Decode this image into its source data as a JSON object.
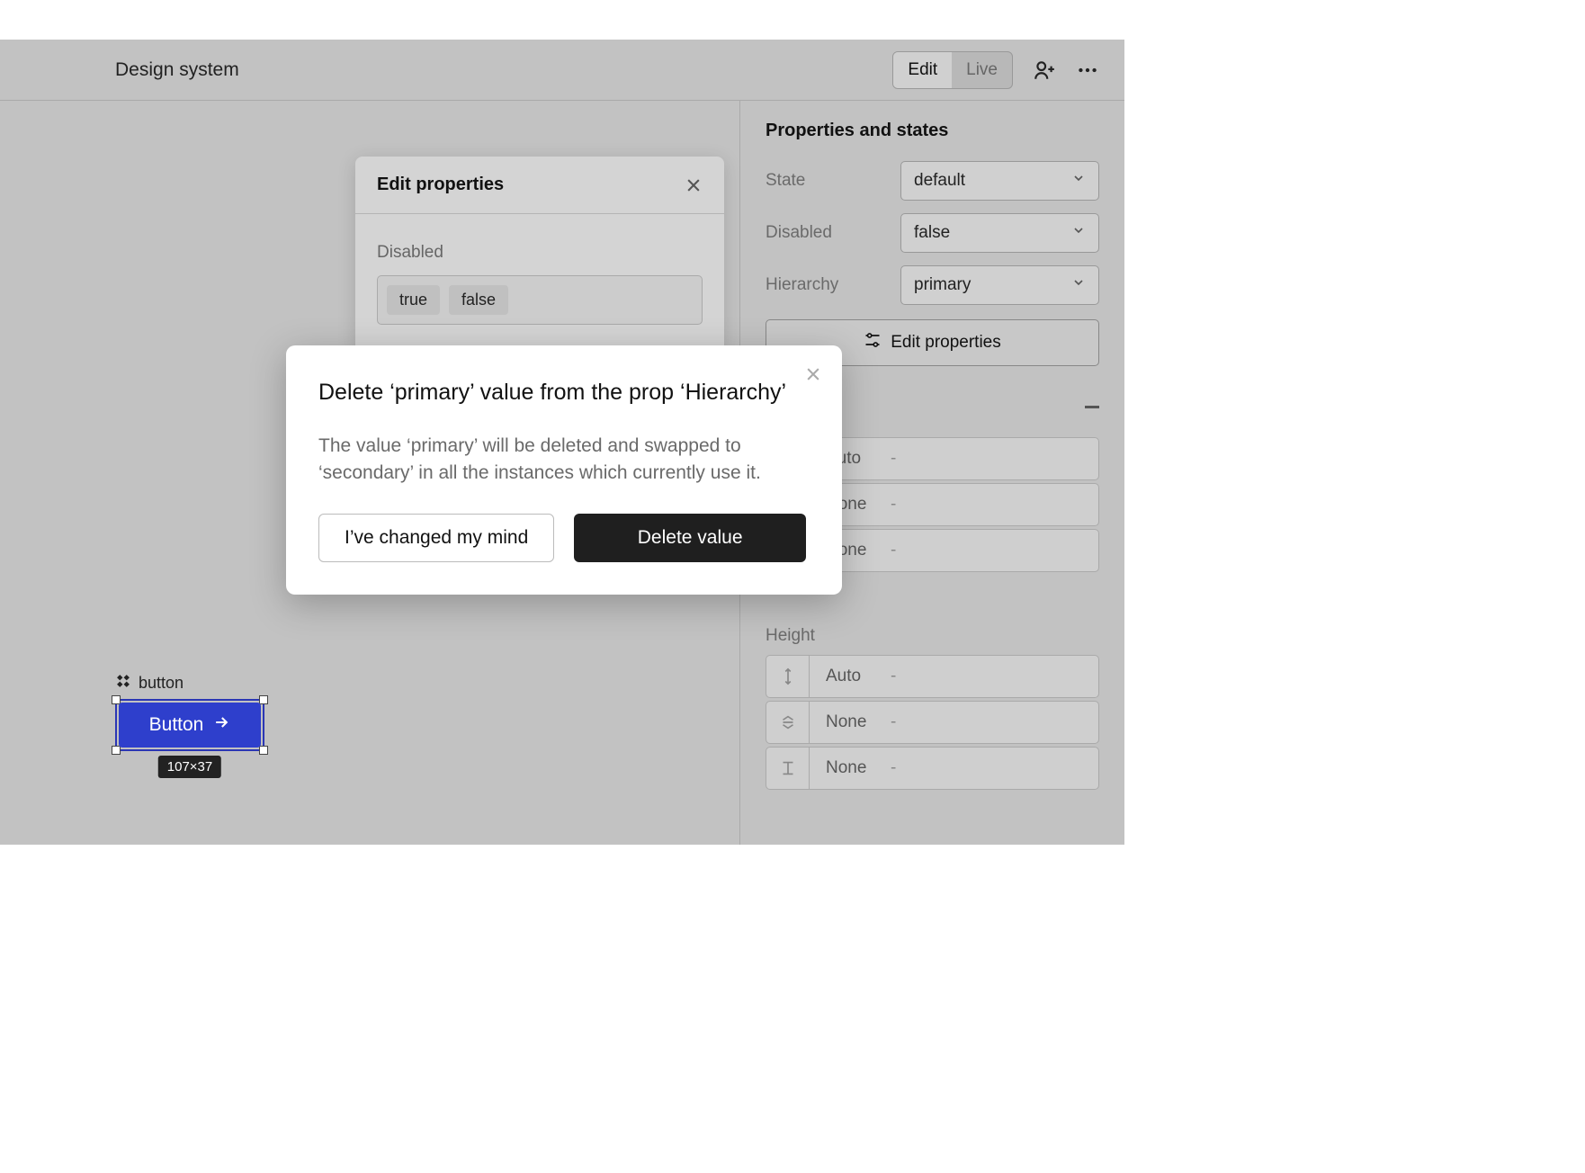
{
  "topbar": {
    "title": "Design system",
    "modes": {
      "edit": "Edit",
      "live": "Live",
      "active": "edit"
    }
  },
  "right_panel": {
    "title": "Properties and states",
    "props": [
      {
        "label": "State",
        "value": "default"
      },
      {
        "label": "Disabled",
        "value": "false"
      },
      {
        "label": "Hierarchy",
        "value": "primary"
      }
    ],
    "edit_button": "Edit properties",
    "width_rows": [
      {
        "label": "Auto",
        "dash": "-"
      },
      {
        "label": "None",
        "dash": "-"
      },
      {
        "label": "None",
        "dash": "-"
      }
    ],
    "height_section": "Height",
    "height_rows": [
      {
        "label": "Auto",
        "dash": "-"
      },
      {
        "label": "None",
        "dash": "-"
      },
      {
        "label": "None",
        "dash": "-"
      }
    ]
  },
  "edit_panel": {
    "title": "Edit properties",
    "group_label": "Disabled",
    "chips": [
      "true",
      "false"
    ]
  },
  "canvas": {
    "component_name": "button",
    "button_text": "Button",
    "size_badge": "107×37"
  },
  "modal": {
    "title": "Delete ‘primary’ value from the prop ‘Hierarchy’",
    "body": "The value ‘primary’ will be deleted and swapped to ‘secondary’ in all the instances which currently use it.",
    "cancel": "I’ve changed my mind",
    "confirm": "Delete value"
  }
}
